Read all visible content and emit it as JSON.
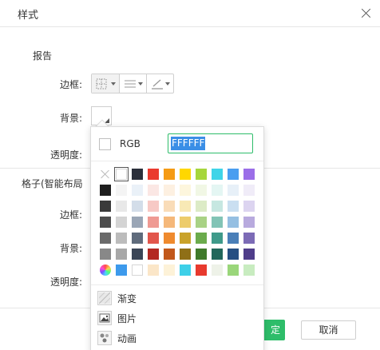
{
  "dialog": {
    "title": "样式"
  },
  "report": {
    "section_label": "报告",
    "border_label": "边框:",
    "background_label": "背景:",
    "opacity_label": "透明度:"
  },
  "cell": {
    "section_label": "格子(智能布局",
    "border_label": "边框:",
    "background_label": "背景:",
    "opacity_label": "透明度:"
  },
  "border_tools": [
    {
      "name": "border-style-icon",
      "has_dropdown": true
    },
    {
      "name": "line-style-icon",
      "has_dropdown": true
    },
    {
      "name": "line-color-icon",
      "has_dropdown": true
    }
  ],
  "picker": {
    "rgb_label": "RGB",
    "hex_value": "FFFFFF",
    "color_rows": [
      [
        "none",
        "#ffffff",
        "#2b2f3a",
        "#ea3a2e",
        "#f59b14",
        "#ffd700",
        "#a6d63c",
        "#3fd4e8",
        "#4a9ef0",
        "#9b6ee8"
      ],
      [
        "#1e1e1e",
        "#f4f4f4",
        "#eaf1f8",
        "#fbe7e4",
        "#fdf0e1",
        "#fdf6dd",
        "#f1f7e5",
        "#e4f6f3",
        "#e7f0f8",
        "#f0ecf8"
      ],
      [
        "#3a3a3a",
        "#e8e8e8",
        "#d3dde9",
        "#f7c9c5",
        "#f9dcb8",
        "#f8e9b5",
        "#dcebc6",
        "#c6e7e1",
        "#cadff1",
        "#dcd4f0"
      ],
      [
        "#4e4e4e",
        "#d4d4d4",
        "#9aa6b6",
        "#ef9a93",
        "#f5b87a",
        "#edcc6b",
        "#a9d285",
        "#82c4b6",
        "#95bfe2",
        "#b8aade"
      ],
      [
        "#6a6a6a",
        "#bcbcbc",
        "#5f6b7c",
        "#e2564c",
        "#ef8a2e",
        "#c9a22a",
        "#6bab4c",
        "#3f9a8a",
        "#4a7fb8",
        "#7c6bb6"
      ],
      [
        "#888888",
        "#a8a8a8",
        "#3a4556",
        "#b32822",
        "#c2581a",
        "#8f6f17",
        "#3f7a2a",
        "#22675b",
        "#264f82",
        "#4f3d8a"
      ],
      [
        "wheel",
        "#3d9aec",
        "#ffffff",
        "#fbe6c8",
        "#fdf2d8",
        "#3ed0e8",
        "#e83a2e",
        "#eef2e8",
        "#9ad67a",
        "#c8ecc0"
      ]
    ],
    "fill_options": [
      {
        "icon": "gradient-icon",
        "label": "渐变"
      },
      {
        "icon": "image-icon",
        "label": "图片"
      },
      {
        "icon": "animation-icon",
        "label": "动画"
      }
    ]
  },
  "footer": {
    "ok_label": "确定",
    "ok_visible_text": "定",
    "cancel_label": "取消"
  }
}
